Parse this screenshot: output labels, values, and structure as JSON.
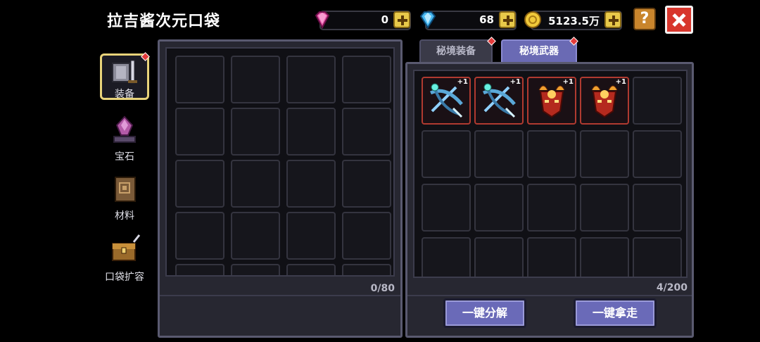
{
  "header": {
    "title": "拉吉酱次元口袋",
    "currencies": [
      {
        "icon": "pink-gem-icon",
        "value": "0"
      },
      {
        "icon": "blue-diamond-icon",
        "value": "68"
      },
      {
        "icon": "gold-coin-icon",
        "value": "5123.5万"
      }
    ],
    "help_label": "?"
  },
  "sidebar": {
    "items": [
      {
        "label": "装备",
        "icon": "armor-icon",
        "active": true
      },
      {
        "label": "宝石",
        "icon": "gem-stand-icon",
        "active": false
      },
      {
        "label": "材料",
        "icon": "material-book-icon",
        "active": false
      },
      {
        "label": "口袋扩容",
        "icon": "treasure-chest-icon",
        "active": false
      }
    ]
  },
  "pocket": {
    "count": "0/80"
  },
  "tabs": [
    {
      "label": "秘境装备",
      "active": false
    },
    {
      "label": "秘境武器",
      "active": true
    }
  ],
  "storage": {
    "count": "4/200",
    "items": [
      {
        "icon": "crossbow-icon",
        "badge": "+1"
      },
      {
        "icon": "crossbow-icon",
        "badge": "+1"
      },
      {
        "icon": "demon-mask-icon",
        "badge": "+1"
      },
      {
        "icon": "demon-mask-icon",
        "badge": "+1"
      }
    ]
  },
  "actions": {
    "dismantle_label": "一键分解",
    "take_all_label": "一键拿走"
  },
  "colors": {
    "background": "#000000",
    "panel": "#272731",
    "accent": "#6a6ab8",
    "close": "#d8362c",
    "gold": "#e8c94a"
  }
}
